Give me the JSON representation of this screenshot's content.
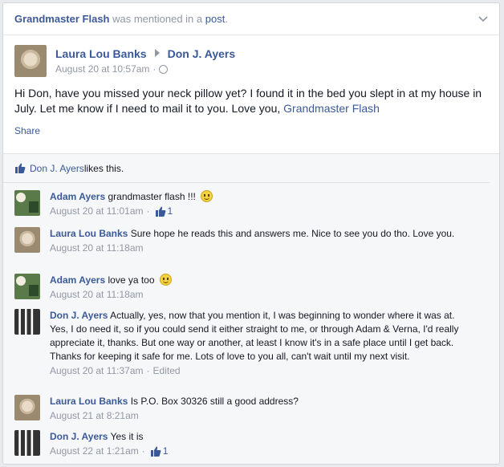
{
  "header": {
    "actor": "Grandmaster Flash",
    "mention_text": " was mentioned in a ",
    "post_link": "post",
    "tail": "."
  },
  "post": {
    "author": "Laura Lou Banks",
    "recipient": "Don J. Ayers",
    "timestamp": "August 20 at 10:57am",
    "separator": "·",
    "text_before": "Hi Don, have you missed your neck pillow yet? I found it in the bed you slept in at my house in July. Let me know if I need to mail it to you. Love you, ",
    "text_mention": "Grandmaster Flash",
    "share_label": "Share"
  },
  "likes": {
    "name": "Don J. Ayers",
    "suffix": " likes this."
  },
  "comments": [
    {
      "author": "Adam Ayers",
      "text": " grandmaster flash !!! ",
      "time": "August 20 at 11:01am",
      "separator": "·",
      "likes": "1"
    },
    {
      "author": "Laura Lou Banks",
      "text": " Sure hope he reads this and answers me. Nice to see you do tho. Love you.",
      "time": "August 20 at 11:18am"
    },
    {
      "author": "Adam Ayers",
      "text": " love ya too ",
      "time": "August 20 at 11:18am"
    },
    {
      "author": "Don J. Ayers",
      "text": " Actually, yes, now that you mention it, I was beginning to wonder where it was at. Yes, I do need it, so if you could send it either straight to me, or through Adam & Verna, I'd really appreciate it, thanks. But one way or another, at least I know it's in a safe place until I get back. Thanks for keeping it safe for me. Lots of love to you all, can't wait until my next visit.",
      "time": "August 20 at 11:37am",
      "separator": "·",
      "edited": "Edited"
    },
    {
      "author": "Laura Lou Banks",
      "text": " Is P.O. Box 30326 still a good address?",
      "time": "August 21 at 8:21am"
    },
    {
      "author": "Don J. Ayers",
      "text": " Yes it is",
      "time": "August 22 at 1:21am",
      "separator": "·",
      "likes": "1"
    }
  ],
  "colors": {
    "link": "#3b5998",
    "meta": "#9197a3",
    "feedback_bg": "#f6f7f8"
  },
  "icons": [
    "chevron-down-icon",
    "arrow-right-icon",
    "globe-icon",
    "thumbs-up-icon",
    "smiley-icon"
  ]
}
